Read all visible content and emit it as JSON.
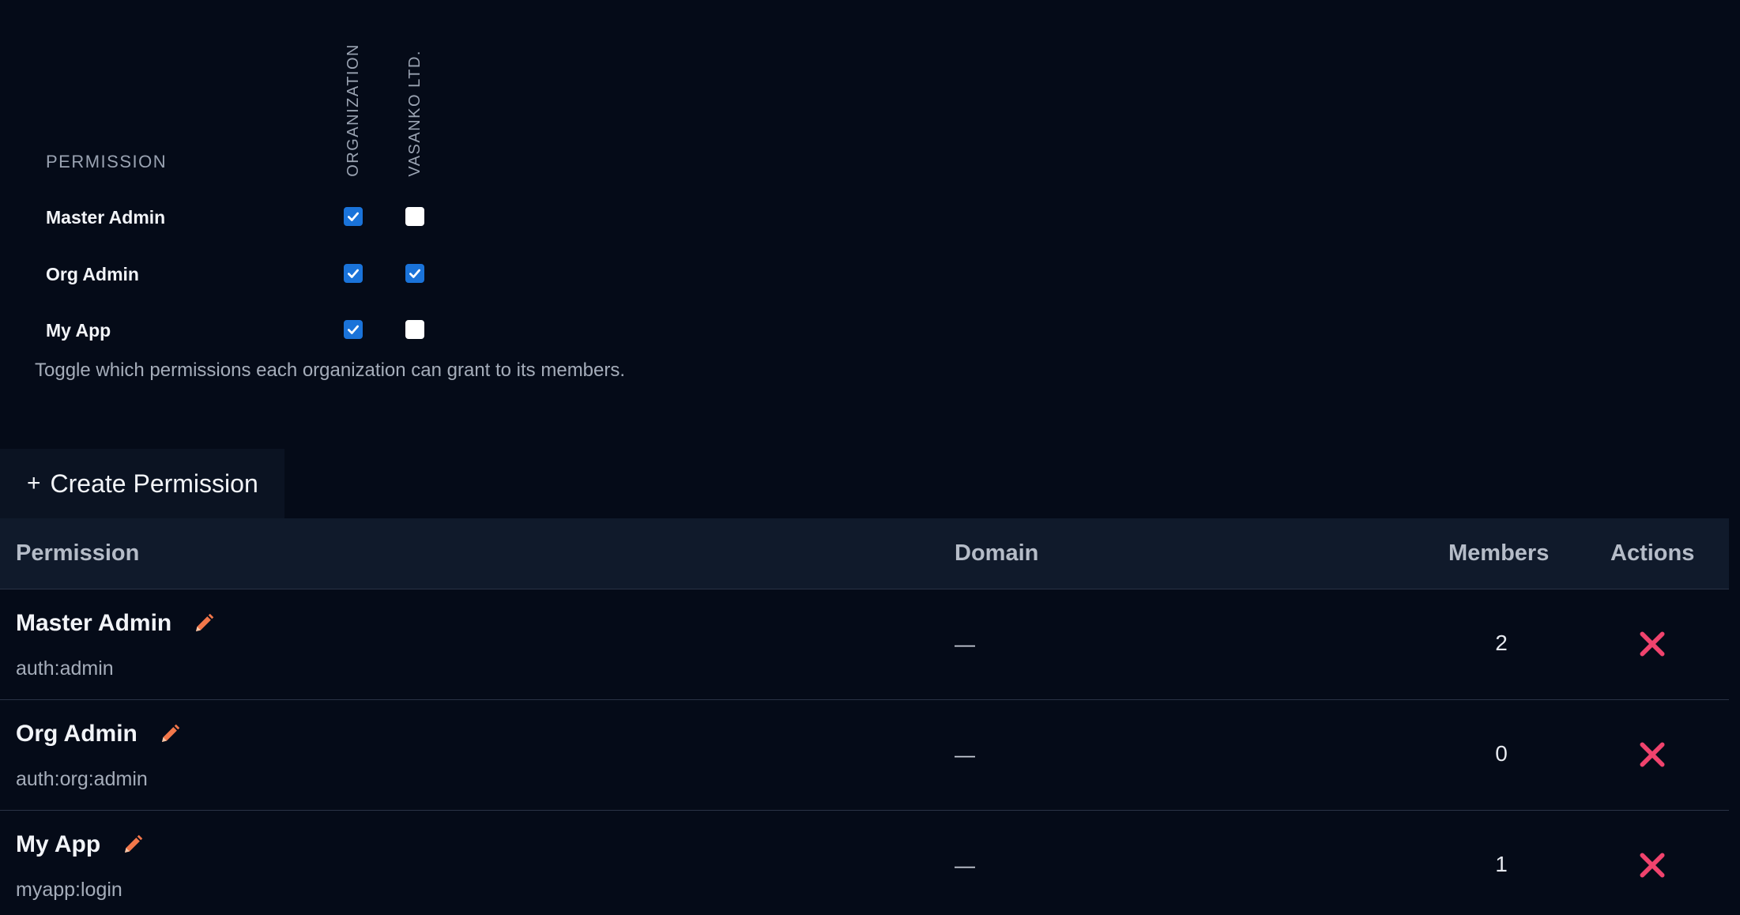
{
  "matrix": {
    "permission_header": "PERMISSION",
    "columns": [
      "ORGANIZATION",
      "VASANKO LTD."
    ],
    "rows": [
      {
        "label": "Master Admin",
        "checks": [
          true,
          false
        ]
      },
      {
        "label": "Org Admin",
        "checks": [
          true,
          true
        ]
      },
      {
        "label": "My App",
        "checks": [
          true,
          false
        ]
      }
    ],
    "hint": "Toggle which permissions each organization can grant to its members."
  },
  "create_button": {
    "plus": "+",
    "label": "Create Permission"
  },
  "table": {
    "headers": {
      "permission": "Permission",
      "domain": "Domain",
      "members": "Members",
      "actions": "Actions"
    },
    "rows": [
      {
        "name": "Master Admin",
        "code": "auth:admin",
        "domain": "—",
        "members": "2"
      },
      {
        "name": "Org Admin",
        "code": "auth:org:admin",
        "domain": "—",
        "members": "0"
      },
      {
        "name": "My App",
        "code": "myapp:login",
        "domain": "—",
        "members": "1"
      }
    ]
  },
  "colors": {
    "background": "#050b18",
    "checkbox_checked": "#1a73d9",
    "edit_icon": "#f2774a",
    "delete_icon": "#f0436d"
  },
  "icons": {
    "edit": "pencil-icon",
    "delete": "close-icon",
    "check": "check-icon"
  }
}
